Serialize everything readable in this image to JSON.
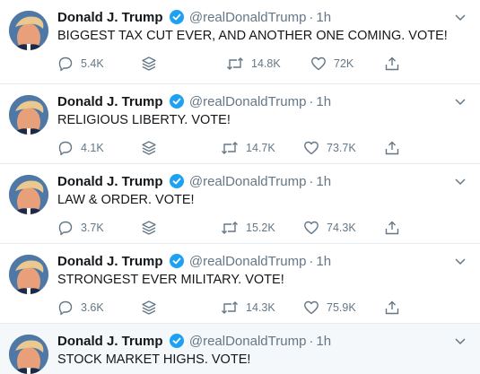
{
  "author": {
    "name": "Donald J. Trump",
    "handle": "@realDonaldTrump",
    "dot": "·"
  },
  "tweets": [
    {
      "time": "1h",
      "text": "BIGGEST TAX CUT EVER, AND ANOTHER ONE COMING. VOTE!",
      "replies": "5.4K",
      "retweets": "14.8K",
      "likes": "72K"
    },
    {
      "time": "1h",
      "text": "RELIGIOUS LIBERTY. VOTE!",
      "replies": "4.1K",
      "retweets": "14.7K",
      "likes": "73.7K"
    },
    {
      "time": "1h",
      "text": "LAW & ORDER. VOTE!",
      "replies": "3.7K",
      "retweets": "15.2K",
      "likes": "74.3K"
    },
    {
      "time": "1h",
      "text": "STRONGEST EVER MILITARY. VOTE!",
      "replies": "3.6K",
      "retweets": "14.3K",
      "likes": "75.9K"
    },
    {
      "time": "1h",
      "text": "STOCK MARKET HIGHS. VOTE!"
    }
  ],
  "icons": {
    "reply": "reply-icon",
    "stack": "stack-icon",
    "retweet": "retweet-icon",
    "like": "like-icon",
    "share": "share-icon",
    "verified": "verified-badge-icon",
    "caret": "chevron-down-icon"
  },
  "colors": {
    "accent": "#1da1f2",
    "muted": "#657786",
    "text": "#14171a"
  }
}
